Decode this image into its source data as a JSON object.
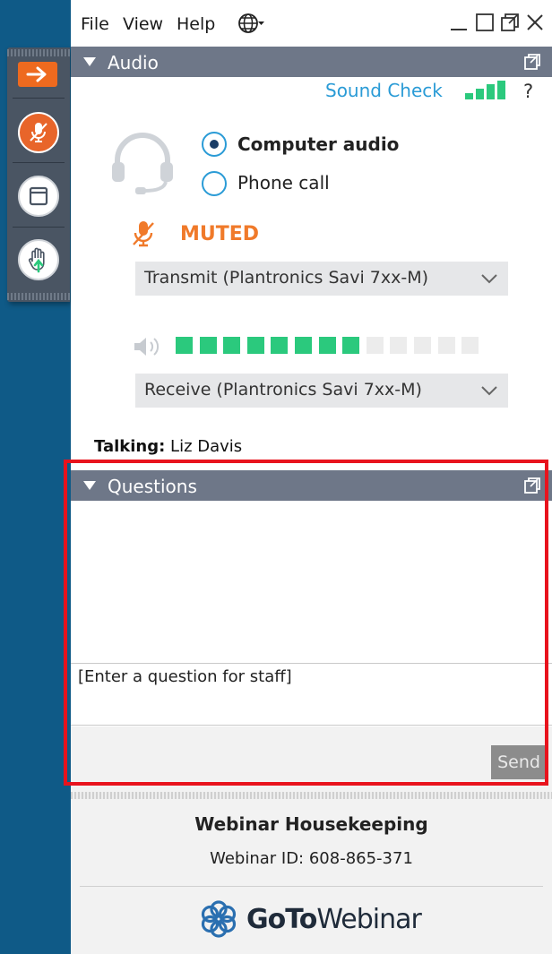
{
  "menubar": {
    "items": [
      "File",
      "View",
      "Help"
    ]
  },
  "audio": {
    "section_title": "Audio",
    "sound_check": "Sound Check",
    "help_symbol": "?",
    "options": [
      "Computer audio",
      "Phone call"
    ],
    "selected_option": "Computer audio",
    "muted_label": "MUTED",
    "transmit_device": "Transmit (Plantronics Savi 7xx-M)",
    "receive_device": "Receive (Plantronics Savi 7xx-M)",
    "speaker_level": {
      "active_segments": 8,
      "total_segments": 13
    },
    "talking_label": "Talking:",
    "talking_name": "Liz Davis"
  },
  "questions": {
    "section_title": "Questions",
    "input_placeholder": "[Enter a question for staff]",
    "send_label": "Send"
  },
  "footer": {
    "webinar_title": "Webinar Housekeeping",
    "webinar_id": "Webinar ID: 608-865-371",
    "brand_goto": "GoTo",
    "brand_webinar": "Webinar"
  },
  "icons": {
    "strip": [
      "expand-arrow-icon",
      "microphone-muted-icon",
      "window-icon",
      "raise-hand-icon"
    ],
    "menubar": [
      "globe-icon",
      "minimize-icon",
      "maximize-icon",
      "restore-icon",
      "close-icon"
    ]
  },
  "colors": {
    "background": "#0f5a87",
    "section_bar": "#6e7788",
    "accent_orange": "#f07a2a",
    "link_blue": "#2a9bd6",
    "level_green": "#2bc97d",
    "highlight_red": "#e8131d"
  }
}
